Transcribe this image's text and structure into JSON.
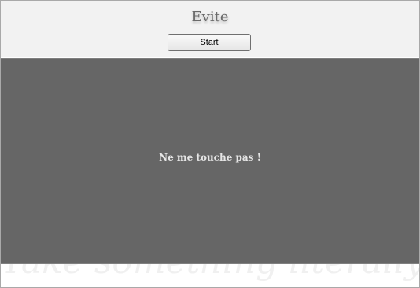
{
  "header": {
    "title": "Evite",
    "start_label": "Start"
  },
  "play_area": {
    "message": "Ne me touche pas !"
  },
  "footer": {
    "watermark": "Take something literally"
  }
}
